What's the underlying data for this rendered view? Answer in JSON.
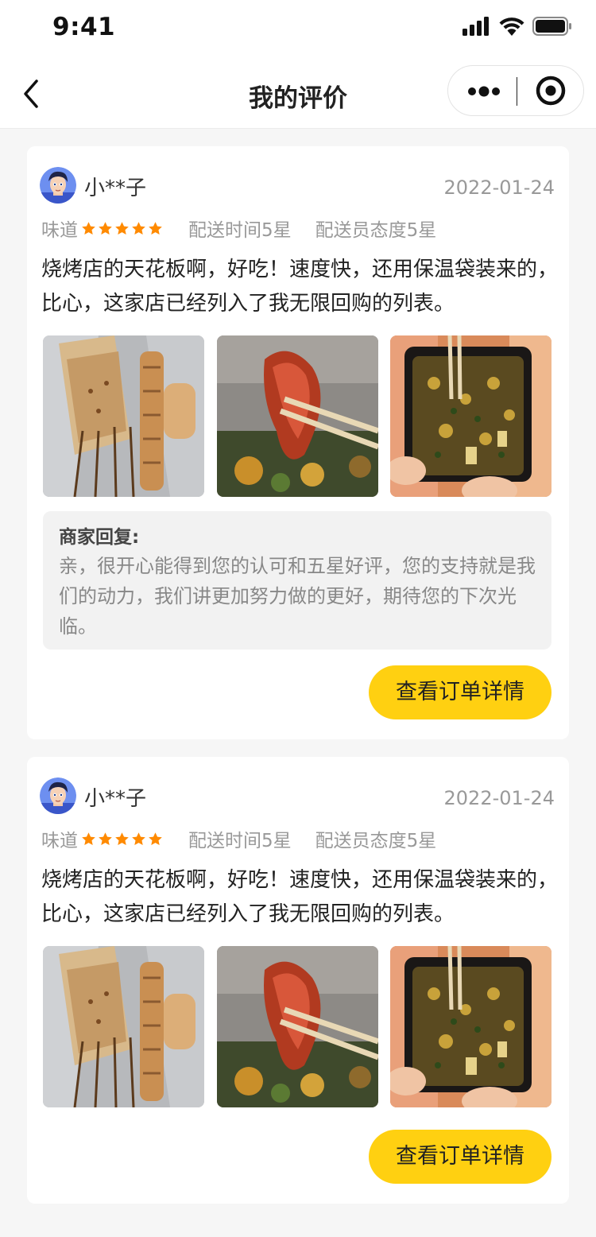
{
  "status_bar": {
    "time": "9:41"
  },
  "nav": {
    "title": "我的评价",
    "icons": [
      "back-chevron-icon",
      "more-dots-icon",
      "close-target-icon"
    ]
  },
  "colors": {
    "accent": "#ffd011",
    "star": "#ff8a00",
    "page_bg": "#f6f6f6",
    "reply_bg": "#f2f2f2"
  },
  "reviews": [
    {
      "username": "小**子",
      "date": "2022-01-24",
      "rating_label": "味道",
      "stars": 5,
      "delivery_time": "配送时间5星",
      "courier_attitude": "配送员态度5星",
      "text": "烧烤店的天花板啊，好吃！速度快，还用保温袋装来的，比心，这家店已经列入了我无限回购的列表。",
      "photos": [
        "bbq-skewers",
        "meat-with-chopsticks",
        "stir-fry-box"
      ],
      "merchant_reply": {
        "title": "商家回复:",
        "text": "亲，很开心能得到您的认可和五星好评，您的支持就是我们的动力，我们讲更加努力做的更好，期待您的下次光临。"
      },
      "button": "查看订单详情"
    },
    {
      "username": "小**子",
      "date": "2022-01-24",
      "rating_label": "味道",
      "stars": 5,
      "delivery_time": "配送时间5星",
      "courier_attitude": "配送员态度5星",
      "text": "烧烤店的天花板啊，好吃！速度快，还用保温袋装来的，比心，这家店已经列入了我无限回购的列表。",
      "photos": [
        "bbq-skewers",
        "meat-with-chopsticks",
        "stir-fry-box"
      ],
      "button": "查看订单详情"
    }
  ]
}
